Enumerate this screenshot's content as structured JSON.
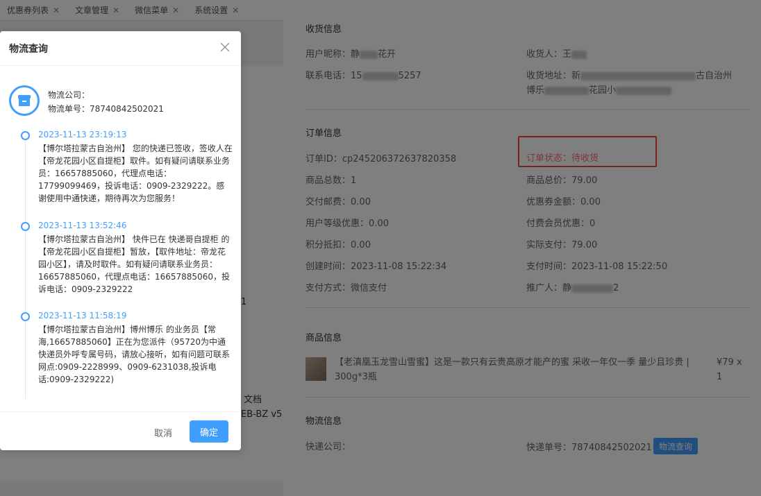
{
  "tabs": [
    {
      "label": "优惠券列表"
    },
    {
      "label": "文章管理"
    },
    {
      "label": "微信菜单"
    },
    {
      "label": "系统设置"
    }
  ],
  "background_fragments": {
    "f1": "1",
    "f2": "文档",
    "f3": "EB-BZ v5"
  },
  "receiving": {
    "title": "收货信息",
    "nickname_label": "用户昵称：",
    "nickname_value": "静",
    "nickname_tail": "花开",
    "receiver_label": "收货人：",
    "receiver_value": "王",
    "phone_label": "联系电话：",
    "phone_value": "15",
    "phone_tail": "5257",
    "address_label": "收货地址：",
    "address_line1_head": "新",
    "address_line1_tail": "古自治州",
    "address_line2_head": "博乐",
    "address_line2_mid": "花园小"
  },
  "order": {
    "title": "订单信息",
    "order_id_label": "订单ID：",
    "order_id": "cp245206372637820358",
    "status_label": "订单状态：",
    "status_value": "待收货",
    "total_qty_label": "商品总数：",
    "total_qty": "1",
    "total_price_label": "商品总价：",
    "total_price": "79.00",
    "postage_label": "交付邮费：",
    "postage": "0.00",
    "coupon_label": "优惠券金额：",
    "coupon": "0.00",
    "level_discount_label": "用户等级优惠：",
    "level_discount": "0.00",
    "member_discount_label": "付费会员优惠：",
    "member_discount": "0",
    "points_label": "积分抵扣：",
    "points": "0.00",
    "actual_pay_label": "实际支付：",
    "actual_pay": "79.00",
    "created_label": "创建时间：",
    "created": "2023-11-08 15:22:34",
    "paid_label": "支付时间：",
    "paid": "2023-11-08 15:22:50",
    "pay_method_label": "支付方式：",
    "pay_method": "微信支付",
    "promoter_label": "推广人：",
    "promoter": "静",
    "promoter_tail": "2"
  },
  "product": {
    "title": "商品信息",
    "name": "【老滇凰玉龙雪山雪蜜】这是一款只有云贵高原才能产的蜜 采收一年仅一季 量少且珍贵 | 300g*3瓶",
    "price": "¥79 x 1"
  },
  "logistics": {
    "title": "物流信息",
    "company_label": "快递公司：",
    "tracking_label": "快递单号：",
    "tracking_no": "78740842502021",
    "query_button": "物流查询"
  },
  "modal": {
    "title": "物流查询",
    "company_label": "物流公司：",
    "tracking_label": "物流单号：78740842502021",
    "events": [
      {
        "time": "2023-11-13 23:19:13",
        "text": "【博尔塔拉蒙古自治州】 您的快递已签收，签收人在【帝龙花园小区自提柜】取件。如有疑问请联系业务员：16657885060，代理点电话：17799099469，投诉电话：0909-2329222。感谢使用中通快递，期待再次为您服务！"
      },
      {
        "time": "2023-11-13 13:52:46",
        "text": "【博尔塔拉蒙古自治州】 快件已在 快递哥自提柜 的【帝龙花园小区自提柜】暂放，【取件地址：帝龙花园小区】，请及时取件。如有疑问请联系业务员：16657885060，代理点电话：16657885060，投诉电话：0909-2329222"
      },
      {
        "time": "2023-11-13 11:58:19",
        "text": "【博尔塔拉蒙古自治州】博州博乐 的业务员【常海,16657885060】正在为您派件（95720为中通快递员外呼专属号码，请放心接听，如有问题可联系网点:0909-2228999、0909-6231038,投诉电话:0909-2329222)"
      }
    ],
    "cancel_label": "取消",
    "ok_label": "确定"
  }
}
